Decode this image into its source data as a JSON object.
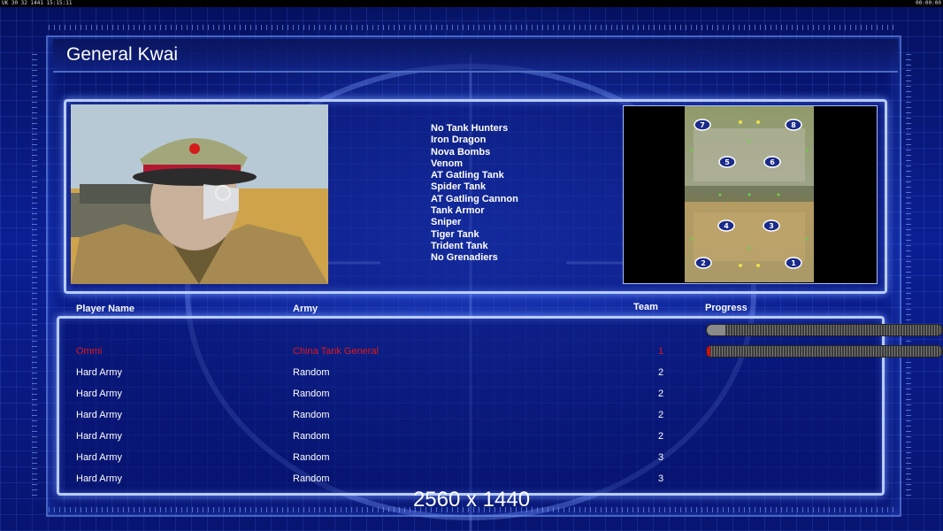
{
  "topbar": {
    "left_text": "UK 30 32 1441 15:15:11",
    "right_text": "00:00:00"
  },
  "general": {
    "name": "General Kwai"
  },
  "restrictions": [
    "No Tank Hunters",
    "Iron Dragon",
    "Nova Bombs",
    "Venom",
    "AT Gatling Tank",
    "Spider Tank",
    "AT Gatling Cannon",
    "Tank Armor",
    "Sniper",
    "Tiger Tank",
    "Trident Tank",
    "No Grenadiers"
  ],
  "minimap": {
    "start_positions": [
      "7",
      "8",
      "5",
      "6",
      "4",
      "3",
      "2",
      "1"
    ]
  },
  "table": {
    "headers": {
      "player": "Player Name",
      "army": "Army",
      "team": "Team",
      "progress": "Progress"
    },
    "rows": [
      {
        "name": "Ommi",
        "army": "China Tank General",
        "team": "1",
        "progress": 0.08,
        "highlight": true
      },
      {
        "name": "Hard Army",
        "army": "Random",
        "team": "2",
        "progress": 0.0
      },
      {
        "name": "Hard Army",
        "army": "Random",
        "team": "2",
        "progress": 0.0
      },
      {
        "name": "Hard Army",
        "army": "Random",
        "team": "2",
        "progress": 0.0
      },
      {
        "name": "Hard Army",
        "army": "Random",
        "team": "2",
        "progress": 0.0
      },
      {
        "name": "Hard Army",
        "army": "Random",
        "team": "3",
        "progress": 0.0
      },
      {
        "name": "Hard Army",
        "army": "Random",
        "team": "3",
        "progress": 0.0
      }
    ]
  },
  "resolution": "2560 x 1440",
  "colors": {
    "highlight": "#e01818",
    "frame": "#b9ccff",
    "progress_fill": "#8a8a8a",
    "progress_marker": "#d01010"
  }
}
